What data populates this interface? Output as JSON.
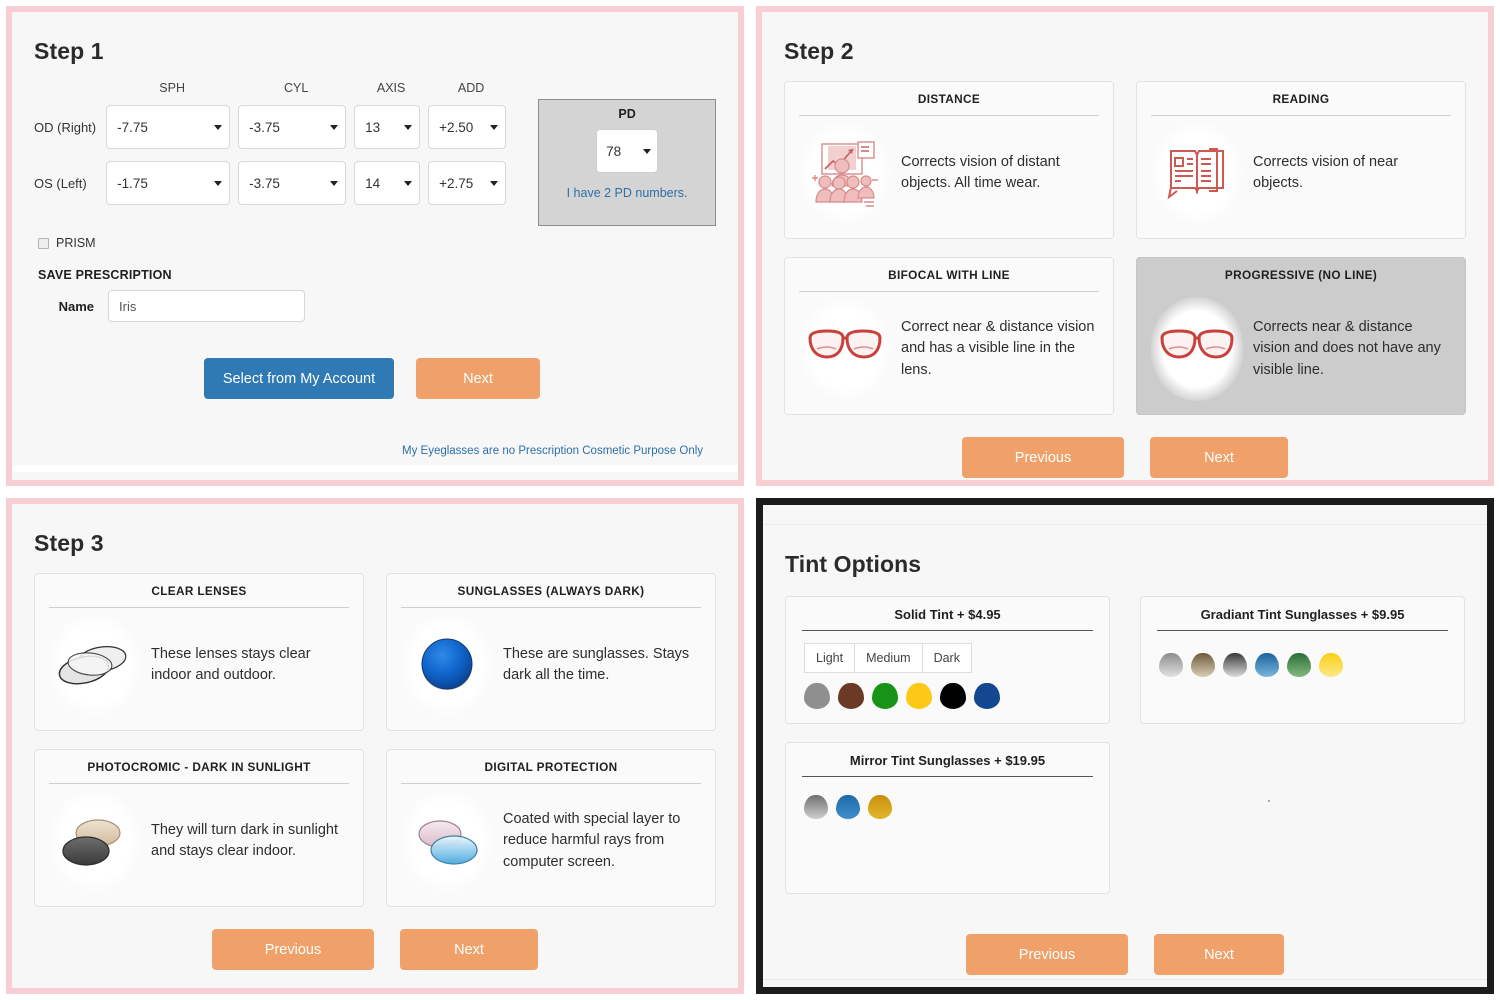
{
  "colors": {
    "frame_pink": "#f7ced3",
    "frame_black": "#1c1c1c",
    "accent_orange": "#efa169",
    "accent_blue": "#2f79b5",
    "link_blue": "#2d6fa8",
    "selected_gray": "#cccccc",
    "icon_red": "#d4584f"
  },
  "step1": {
    "title": "Step 1",
    "columns": [
      "SPH",
      "CYL",
      "AXIS",
      "ADD"
    ],
    "rows": [
      {
        "label": "OD (Right)",
        "sph": "-7.75",
        "cyl": "-3.75",
        "axis": "13",
        "add": "+2.50"
      },
      {
        "label": "OS (Left)",
        "sph": "-1.75",
        "cyl": "-3.75",
        "axis": "14",
        "add": "+2.75"
      }
    ],
    "pd": {
      "title": "PD",
      "value": "78",
      "link": "I have 2 PD numbers."
    },
    "prism_label": "PRISM",
    "save_title": "SAVE PRESCRIPTION",
    "name_label": "Name",
    "name_value": "Iris",
    "name_placeholder": "Name",
    "account_button": "Select from My Account",
    "next_button": "Next",
    "cosmetic_link": "My Eyeglasses are no Prescription Cosmetic Purpose Only"
  },
  "step2": {
    "title": "Step 2",
    "cards": [
      {
        "title": "DISTANCE",
        "text": "Corrects vision of distant objects. All time wear.",
        "icon": "presentation-audience-icon",
        "selected": false
      },
      {
        "title": "READING",
        "text": "Corrects vision of near objects.",
        "icon": "open-book-icon",
        "selected": false
      },
      {
        "title": "BIFOCAL WITH LINE",
        "text": "Correct near & distance vision and has a visible line in the lens.",
        "icon": "eyeglasses-icon",
        "selected": false
      },
      {
        "title": "PROGRESSIVE (NO LINE)",
        "text": "Corrects near & distance vision and does not have any visible line.",
        "icon": "eyeglasses-icon",
        "selected": true
      }
    ],
    "previous_button": "Previous",
    "next_button": "Next"
  },
  "step3": {
    "title": "Step 3",
    "cards": [
      {
        "title": "CLEAR LENSES",
        "text": "These lenses stays clear indoor and outdoor.",
        "icon": "clear-lens-icon",
        "selected": false
      },
      {
        "title": "SUNGLASSES (ALWAYS DARK)",
        "text": "These are sunglasses. Stays dark all the time.",
        "icon": "blue-lens-icon",
        "selected": false
      },
      {
        "title": "PHOTOCROMIC - DARK IN SUNLIGHT",
        "text": "They will turn dark in sunlight and stays clear indoor.",
        "icon": "photochromic-lens-icon",
        "selected": false
      },
      {
        "title": "DIGITAL PROTECTION",
        "text": "Coated with special layer to reduce harmful rays from computer screen.",
        "icon": "digital-lens-icon",
        "selected": false
      }
    ],
    "previous_button": "Previous",
    "next_button": "Next"
  },
  "tint": {
    "title": "Tint Options",
    "solid": {
      "title": "Solid Tint + $4.95",
      "intensities": [
        "Light",
        "Medium",
        "Dark"
      ],
      "swatches": [
        "#8f8f8f",
        "#6b3a27",
        "#179417",
        "#fbc916",
        "#000000",
        "#13478f"
      ]
    },
    "gradient": {
      "title": "Gradiant Tint Sunglasses + $9.95",
      "swatches": [
        "#8c8c8c",
        "#6e5b3c",
        "#4d4d4d",
        "#2a72ab",
        "#2f7a3c",
        "#fbcf17"
      ]
    },
    "mirror": {
      "title": "Mirror Tint Sunglasses + $19.95",
      "swatches": [
        "#8e8e8e",
        "#2c74ae",
        "#d39d10"
      ]
    },
    "previous_button": "Previous",
    "next_button": "Next"
  }
}
